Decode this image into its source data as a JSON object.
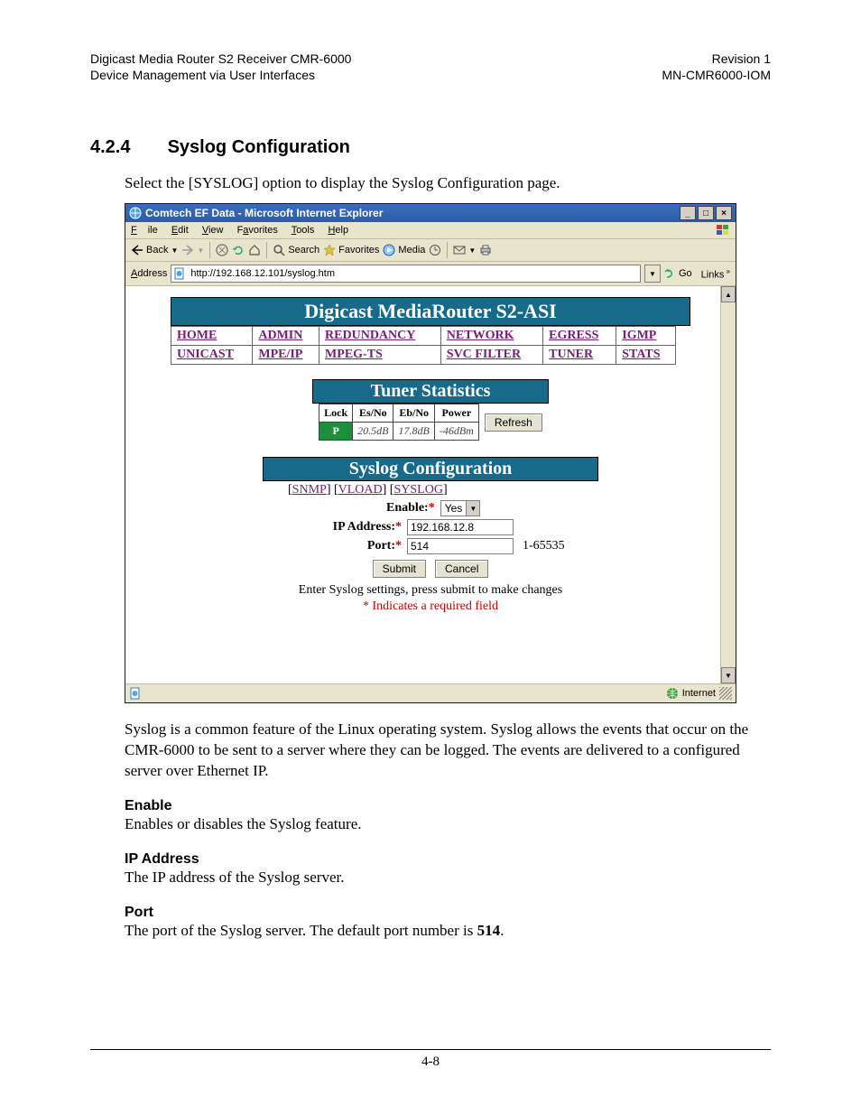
{
  "header": {
    "left": "Digicast Media Router S2 Receiver CMR-6000\nDevice Management via User Interfaces",
    "right": "Revision 1\nMN-CMR6000-IOM"
  },
  "section": {
    "number": "4.2.4",
    "title": "Syslog Configuration",
    "intro": "Select the [SYSLOG] option to display the Syslog Configuration page."
  },
  "browser": {
    "title": "Comtech EF Data - Microsoft Internet Explorer",
    "menu": {
      "file": "File",
      "edit": "Edit",
      "view": "View",
      "favorites": "Favorites",
      "tools": "Tools",
      "help": "Help"
    },
    "toolbar": {
      "back": "Back",
      "search": "Search",
      "favorites": "Favorites",
      "media": "Media"
    },
    "address_label": "Address",
    "address_value": "http://192.168.12.101/syslog.htm",
    "go": "Go",
    "links": "Links",
    "status_zone": "Internet"
  },
  "webpage": {
    "title": "Digicast MediaRouter S2-ASI",
    "nav_row1": [
      "HOME",
      "ADMIN",
      "REDUNDANCY",
      "NETWORK",
      "EGRESS",
      "IGMP"
    ],
    "nav_row2": [
      "UNICAST",
      "MPE/IP",
      "MPEG-TS",
      "SVC FILTER",
      "TUNER",
      "STATS"
    ],
    "tuner_title": "Tuner Statistics",
    "tuner_headers": [
      "Lock",
      "Es/No",
      "Eb/No",
      "Power"
    ],
    "tuner_values": {
      "lock": "P",
      "esno": "20.5dB",
      "ebno": "17.8dB",
      "power": "-46dBm"
    },
    "refresh": "Refresh",
    "syslog_title": "Syslog Configuration",
    "sublinks": {
      "snmp": "SNMP",
      "vload": "VLOAD",
      "syslog": "SYSLOG"
    },
    "form": {
      "enable_label": "Enable:",
      "enable_value": "Yes",
      "ip_label": "IP Address:",
      "ip_value": "192.168.12.8",
      "port_label": "Port:",
      "port_value": "514",
      "port_hint": "1-65535",
      "submit": "Submit",
      "cancel": "Cancel",
      "instruction": "Enter Syslog settings, press submit to make changes",
      "req_note": "* Indicates a required field"
    }
  },
  "body_text": {
    "p1": "Syslog is a common feature of the Linux operating system. Syslog allows the events that occur on the CMR-6000 to be sent to a server where they can be logged.  The events are delivered to a configured server over Ethernet IP.",
    "h_enable": "Enable",
    "p_enable": "Enables or disables the Syslog feature.",
    "h_ip": "IP Address",
    "p_ip": "The IP address of the Syslog server.",
    "h_port": "Port",
    "p_port_pre": "The port of the Syslog server.  The default port number is ",
    "p_port_bold": "514",
    "p_port_post": "."
  },
  "footer": {
    "page": "4-8"
  }
}
